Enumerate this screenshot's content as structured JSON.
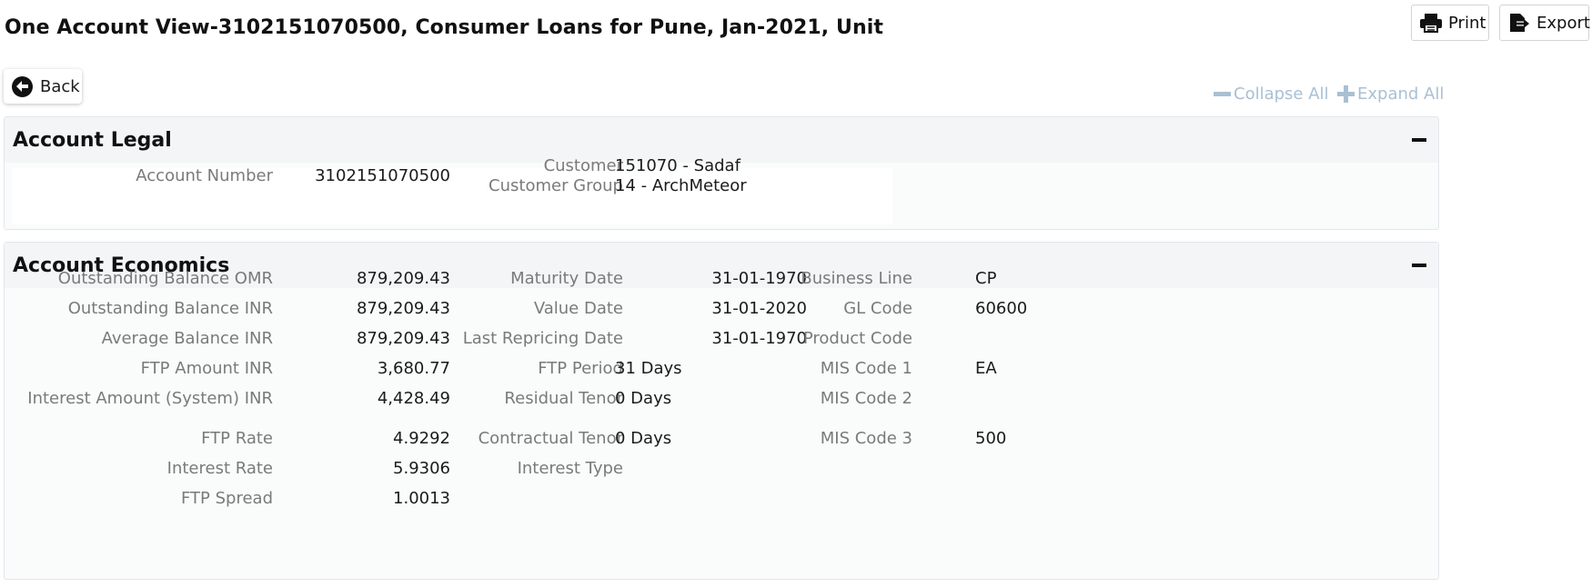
{
  "page": {
    "title": "One Account View-3102151070500, Consumer Loans for Pune, Jan-2021, Unit"
  },
  "toolbar": {
    "print_label": "Print",
    "export_label": "Export",
    "back_label": "Back",
    "collapse_all_label": "Collapse All",
    "expand_all_label": "Expand All"
  },
  "legal": {
    "title": "Account Legal",
    "account_number_label": "Account Number",
    "account_number": "3102151070500",
    "customer_label": "Customer",
    "customer": "151070 - Sadaf",
    "customer_group_label": "Customer Group",
    "customer_group": "14 - ArchMeteor"
  },
  "economics": {
    "title": "Account Economics",
    "col1": [
      {
        "label": "Outstanding Balance OMR",
        "value": "879,209.43"
      },
      {
        "label": "Outstanding Balance INR",
        "value": "879,209.43"
      },
      {
        "label": "Average Balance INR",
        "value": "879,209.43"
      },
      {
        "label": "FTP Amount INR",
        "value": "3,680.77"
      },
      {
        "label": "Interest Amount (System) INR",
        "value": "4,428.49"
      },
      {
        "label": "FTP Rate",
        "value": "4.9292"
      },
      {
        "label": "Interest Rate",
        "value": "5.9306"
      },
      {
        "label": "FTP Spread",
        "value": "1.0013"
      }
    ],
    "col2": [
      {
        "label": "Maturity Date",
        "value": "31-01-1970"
      },
      {
        "label": "Value Date",
        "value": "31-01-2020"
      },
      {
        "label": "Last Repricing Date",
        "value": "31-01-1970"
      },
      {
        "label": "FTP Period",
        "value": "31 Days"
      },
      {
        "label": "Residual Tenor",
        "value": "0 Days"
      },
      {
        "label": "Contractual Tenor",
        "value": "0 Days"
      },
      {
        "label": "Interest Type",
        "value": ""
      }
    ],
    "col3": [
      {
        "label": "Business Line",
        "value": "CP"
      },
      {
        "label": "GL Code",
        "value": "60600"
      },
      {
        "label": "Product Code",
        "value": ""
      },
      {
        "label": "MIS Code 1",
        "value": "EA"
      },
      {
        "label": "MIS Code 2",
        "value": ""
      },
      {
        "label": "MIS Code 3",
        "value": "500"
      }
    ]
  },
  "colors": {
    "link_disabled": "#a9c0d3",
    "label_gray": "#7a7a7a",
    "panel_header": "#f4f5f7"
  },
  "icons": {
    "print": "printer-icon",
    "export": "export-file-icon",
    "back": "arrow-left-circle-icon",
    "collapse": "minus-icon",
    "expand": "plus-icon"
  }
}
